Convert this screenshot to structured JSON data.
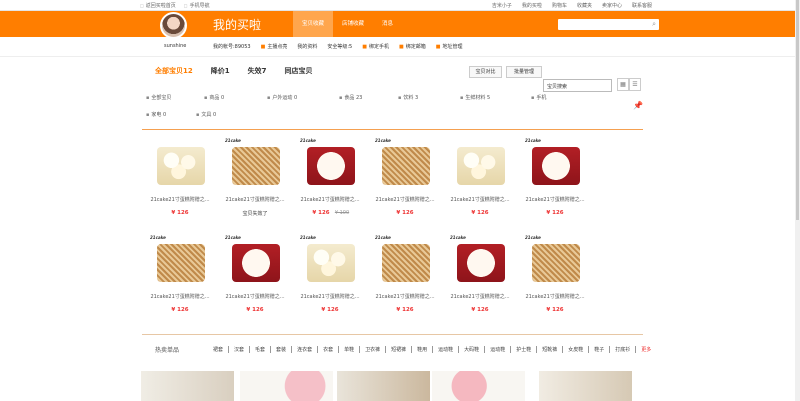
{
  "topbar": {
    "left": [
      "返回买啦首页",
      "手机导航"
    ],
    "right": [
      "吉米小子",
      "我的买啦",
      "购物车",
      "收藏夹",
      "卖家中心",
      "联系客服"
    ]
  },
  "header": {
    "title": "我的买啦",
    "nav": [
      "宝贝收藏",
      "店铺收藏",
      "消息"
    ],
    "active_nav": 0,
    "search_placeholder": ""
  },
  "user": {
    "name": "sunshine",
    "account": "我的帐号:89053",
    "links": [
      "主播点亮",
      "我的资料",
      "安全等级:5",
      "绑定手机",
      "绑定邮箱",
      "地址管理"
    ]
  },
  "tabs": [
    "全部宝贝12",
    "降价1",
    "失效7",
    "同店宝贝"
  ],
  "buttons": {
    "compare": "宝贝对比",
    "batch": "批量管理"
  },
  "filter": {
    "search_value": "宝贝搜索"
  },
  "categories": [
    {
      "label": "全部宝贝"
    },
    {
      "label": "商品 0"
    },
    {
      "label": "户外运动 0"
    },
    {
      "label": "食品 23"
    },
    {
      "label": "饮料 3"
    },
    {
      "label": "生鲜材料 5"
    },
    {
      "label": "手机"
    },
    {
      "label": "家电 0"
    },
    {
      "label": "文具 0"
    }
  ],
  "products": [
    {
      "name": "21cake21寸蛋糕附赠之...",
      "price": "¥ 126",
      "type": "white"
    },
    {
      "name": "21cake21寸蛋糕附赠之...",
      "price": "",
      "status": "宝贝失效了",
      "type": "nut",
      "brand": "21cake"
    },
    {
      "name": "21cake21寸蛋糕附赠之...",
      "price": "¥ 126",
      "old": "¥ 100",
      "type": "red",
      "brand": "21cake"
    },
    {
      "name": "21cake21寸蛋糕附赠之...",
      "price": "¥ 126",
      "type": "nut",
      "brand": "21cake"
    },
    {
      "name": "21cake21寸蛋糕附赠之...",
      "price": "¥ 126",
      "type": "white"
    },
    {
      "name": "21cake21寸蛋糕附赠之...",
      "price": "¥ 126",
      "type": "red",
      "brand": "21cake"
    },
    {
      "name": "21cake21寸蛋糕附赠之...",
      "price": "¥ 126",
      "type": "nut",
      "brand": "21cake"
    },
    {
      "name": "21cake21寸蛋糕附赠之...",
      "price": "¥ 126",
      "type": "red",
      "brand": "21cake"
    },
    {
      "name": "21cake21寸蛋糕附赠之...",
      "price": "¥ 126",
      "type": "white",
      "brand": "21cake"
    },
    {
      "name": "21cake21寸蛋糕附赠之...",
      "price": "¥ 126",
      "type": "nut",
      "brand": "21cake"
    },
    {
      "name": "21cake21寸蛋糕附赠之...",
      "price": "¥ 126",
      "type": "red",
      "brand": "21cake"
    },
    {
      "name": "21cake21寸蛋糕附赠之...",
      "price": "¥ 126",
      "type": "nut",
      "brand": "21cake"
    }
  ],
  "hot": {
    "label": "热卖单品",
    "tags": [
      "裙套",
      "汉套",
      "毛套",
      "套装",
      "连衣套",
      "衣套",
      "单鞋",
      "卫衣裤",
      "短裙裤",
      "鞋用",
      "运动鞋",
      "大码鞋",
      "运动鞋",
      "护士鞋",
      "短靴裤",
      "女皮鞋",
      "鞋子",
      "打底衫",
      "更多"
    ]
  }
}
